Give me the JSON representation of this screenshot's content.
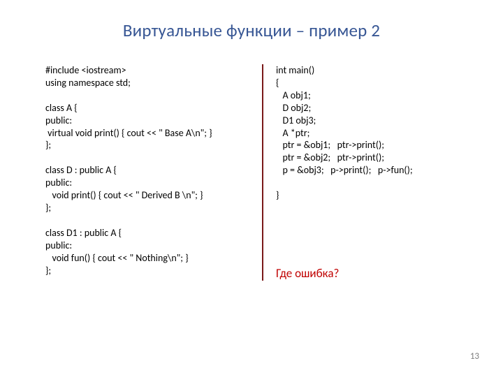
{
  "title": "Виртуальные функции – пример 2",
  "code_left": "#include <iostream>\nusing namespace std;\n\nclass A {\npublic:\n virtual void print() { cout << \" Base A\\n\"; }\n};\n\nclass D : public A {\npublic:\n   void print() { cout << \" Derived B \\n\"; }\n};\n\nclass D1 : public A {\npublic:\n   void fun() { cout << \" Nothing\\n\"; }\n};",
  "code_right": "int main()\n{\n   A obj1;\n   D obj2;\n   D1 obj3;\n   A *ptr;\n   ptr = &obj1;   ptr->print();\n   ptr = &obj2;   ptr->print();\n   p = &obj3;   p->print();   p->fun();\n\n}",
  "question": "Где ошибка?",
  "page_number": "13"
}
